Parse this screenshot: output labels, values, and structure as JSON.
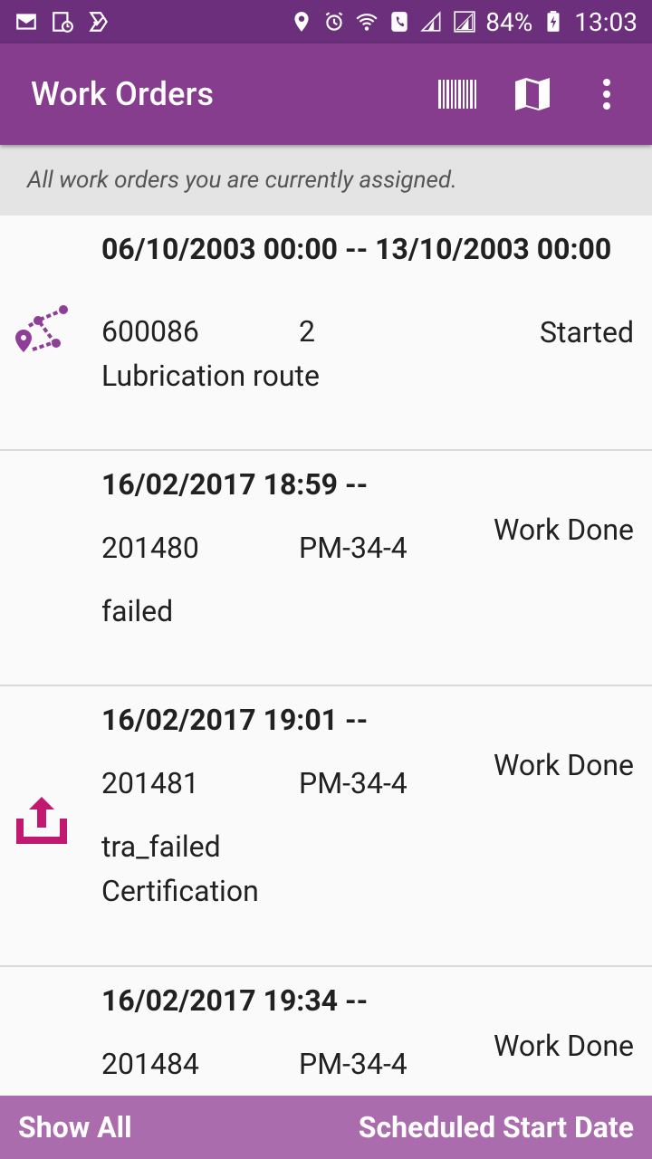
{
  "status_bar": {
    "battery": "84%",
    "time": "13:03",
    "left_icons": [
      "email-icon",
      "calendar-icon",
      "task-icon"
    ],
    "right_icons": [
      "location-icon",
      "alarm-icon",
      "wifi-call-icon",
      "phone-icon",
      "signal-icon",
      "signal-icon",
      "battery-icon"
    ]
  },
  "app_bar": {
    "title": "Work Orders",
    "actions": [
      "barcode-icon",
      "map-icon",
      "more-vert-icon"
    ]
  },
  "subtitle": "All work orders you are currently assigned.",
  "work_orders": [
    {
      "date_range": "06/10/2003 00:00 -- 13/10/2003 00:00",
      "number": "600086",
      "code": "2",
      "status": "Started",
      "description": "Lubrication route",
      "icon": "route-icon",
      "icon_color": "#8e3e97"
    },
    {
      "date_range": "16/02/2017 18:59 --",
      "number": "201480",
      "code": "PM-34-4",
      "status": "Work Done",
      "description": "failed"
    },
    {
      "date_range": "16/02/2017 19:01 --",
      "number": "201481",
      "code": "PM-34-4",
      "status": "Work Done",
      "description": "tra_failed",
      "description2": "Certification",
      "icon": "upload-icon",
      "icon_color": "#c2186f"
    },
    {
      "date_range": "16/02/2017 19:34 --",
      "number": "201484",
      "code": "PM-34-4",
      "status": "Work Done"
    }
  ],
  "bottom_bar": {
    "left_label": "Show All",
    "right_label": "Scheduled Start Date"
  },
  "colors": {
    "status_bar": "#6b2f7b",
    "app_bar": "#873d8e",
    "bottom_bar": "#ab6cae",
    "subtitle_bg": "#e4e4e4"
  }
}
